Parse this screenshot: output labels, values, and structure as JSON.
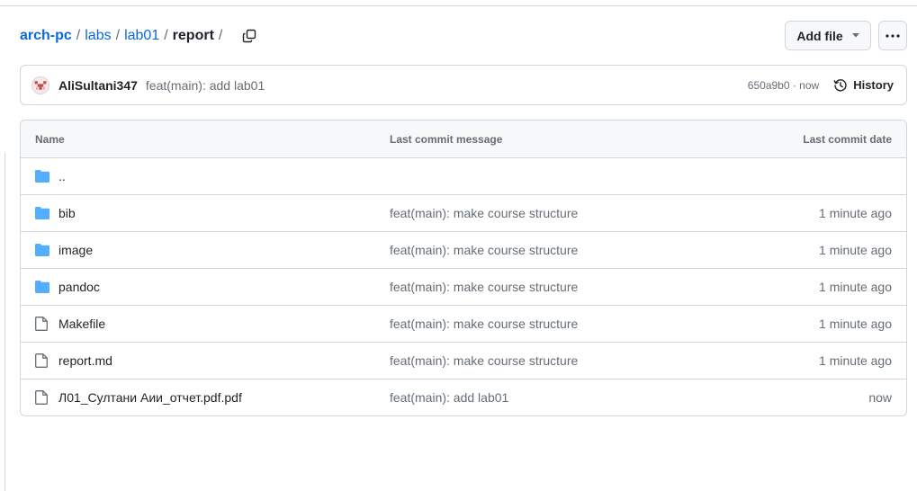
{
  "breadcrumb": {
    "repo": "arch-pc",
    "items": [
      "labs",
      "lab01"
    ],
    "current": "report",
    "separator": "/"
  },
  "buttons": {
    "add_file": "Add file"
  },
  "commit": {
    "author": "AliSultani347",
    "message": "feat(main): add lab01",
    "hash_time": "650a9b0 · now",
    "history": "History"
  },
  "table": {
    "headers": {
      "name": "Name",
      "message": "Last commit message",
      "date": "Last commit date"
    },
    "rows": [
      {
        "name": "..",
        "type": "folder",
        "message": "",
        "date": ""
      },
      {
        "name": "bib",
        "type": "folder",
        "message": "feat(main): make course structure",
        "date": "1 minute ago"
      },
      {
        "name": "image",
        "type": "folder",
        "message": "feat(main): make course structure",
        "date": "1 minute ago"
      },
      {
        "name": "pandoc",
        "type": "folder",
        "message": "feat(main): make course structure",
        "date": "1 minute ago"
      },
      {
        "name": "Makefile",
        "type": "file",
        "message": "feat(main): make course structure",
        "date": "1 minute ago"
      },
      {
        "name": "report.md",
        "type": "file",
        "message": "feat(main): make course structure",
        "date": "1 minute ago"
      },
      {
        "name": "Л01_Султани Аии_отчет.pdf.pdf",
        "type": "file",
        "message": "feat(main): add lab01",
        "date": "now"
      }
    ]
  },
  "colors": {
    "link": "#0969da",
    "folder": "#54aeff",
    "muted": "#656d76",
    "border": "#d0d7de"
  }
}
